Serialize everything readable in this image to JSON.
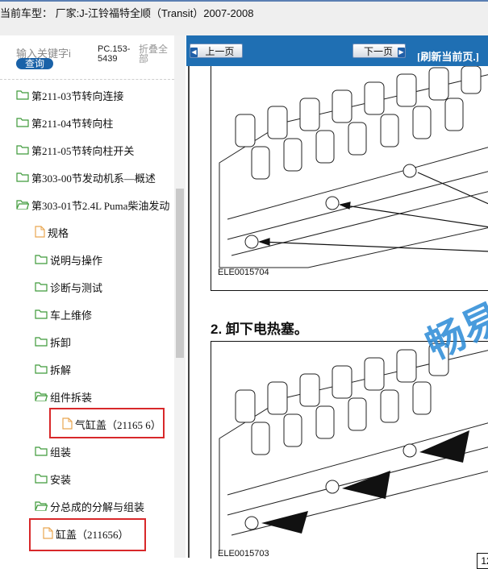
{
  "header": {
    "title": "当前车型： 厂家:J-江铃福特全顺（Transit）2007-2008"
  },
  "search": {
    "keyword_placeholder": "输入关键字i",
    "query_button": "查询",
    "code_label": "PC.153-5439",
    "collapse_all": "折叠全部"
  },
  "tree": {
    "items": [
      {
        "label": "第211-03节转向连接",
        "icon": "folder-icon"
      },
      {
        "label": "第211-04节转向柱",
        "icon": "folder-icon"
      },
      {
        "label": "第211-05节转向柱开关",
        "icon": "folder-icon"
      },
      {
        "label": "第303-00节发动机系—概述",
        "icon": "folder-icon"
      },
      {
        "label": "第303-01节2.4L Puma柴油发动",
        "icon": "folder-open-icon"
      },
      {
        "label": "规格",
        "icon": "page-icon"
      },
      {
        "label": "说明与操作",
        "icon": "folder-icon"
      },
      {
        "label": "诊断与测试",
        "icon": "folder-icon"
      },
      {
        "label": "车上维修",
        "icon": "folder-icon"
      },
      {
        "label": "拆卸",
        "icon": "folder-icon"
      },
      {
        "label": "拆解",
        "icon": "folder-icon"
      },
      {
        "label": "组件拆装",
        "icon": "folder-open-icon"
      },
      {
        "label": "气缸盖（21165 6）",
        "icon": "page-icon"
      },
      {
        "label": "组装",
        "icon": "folder-icon"
      },
      {
        "label": "安装",
        "icon": "folder-icon"
      },
      {
        "label": "分总成的分解与组装",
        "icon": "folder-open-icon"
      },
      {
        "label": "缸盖（211656）",
        "icon": "page-icon"
      }
    ]
  },
  "nav": {
    "prev_label": "上一页",
    "next_label": "下一页",
    "refresh_label": "[刷新当前页.]"
  },
  "document": {
    "figure1_label": "ELE0015704",
    "step_text": "2.  卸下电热塞。",
    "figure2_label": "ELE0015703",
    "watermark": "畅易",
    "page_number": "12"
  },
  "colors": {
    "nav_blue": "#1f6fb3",
    "highlight_red": "#d8282a",
    "folder_green": "#3f9a3a",
    "page_orange": "#e9a650"
  }
}
